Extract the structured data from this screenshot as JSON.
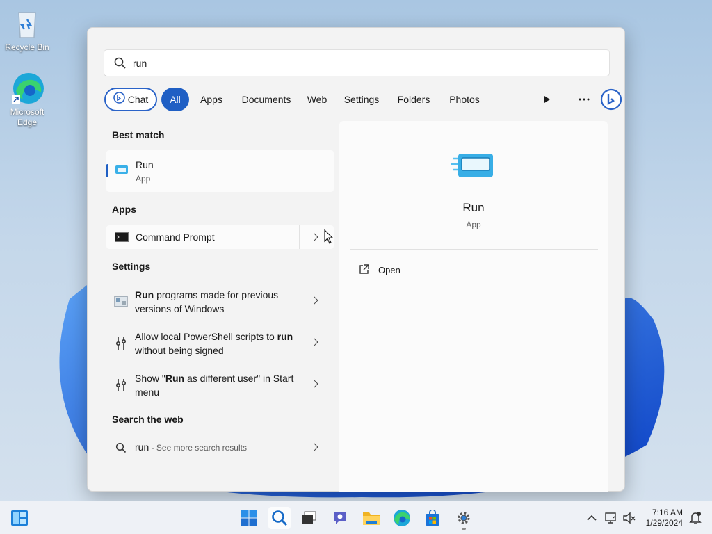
{
  "desktop": {
    "icons": [
      {
        "label": "Recycle Bin"
      },
      {
        "label": "Microsoft Edge"
      }
    ]
  },
  "search": {
    "query": "run",
    "filters": [
      "Chat",
      "All",
      "Apps",
      "Documents",
      "Web",
      "Settings",
      "Folders",
      "Photos"
    ],
    "active_filter": "All"
  },
  "results": {
    "best_match_heading": "Best match",
    "best_match": {
      "title": "Run",
      "subtitle": "App"
    },
    "apps_heading": "Apps",
    "apps": [
      {
        "title": "Command Prompt"
      }
    ],
    "settings_heading": "Settings",
    "settings": [
      {
        "bold": "Run",
        "rest": " programs made for previous versions of Windows"
      },
      {
        "pre": "Allow local PowerShell scripts to ",
        "bold": "run",
        "rest": " without being signed"
      },
      {
        "pre": "Show \"",
        "bold": "Run",
        "rest": " as different user\" in Start menu"
      }
    ],
    "web_heading": "Search the web",
    "web": {
      "query": "run",
      "suffix": " - See more search results"
    }
  },
  "detail": {
    "name": "Run",
    "type": "App",
    "actions": [
      {
        "label": "Open"
      }
    ]
  },
  "taskbar": {
    "time": "7:16 AM",
    "date": "1/29/2024"
  },
  "colors": {
    "accent": "#1f5fc4",
    "panel_bg": "#f3f3f3",
    "taskbar_bg": "#eef1f6"
  }
}
